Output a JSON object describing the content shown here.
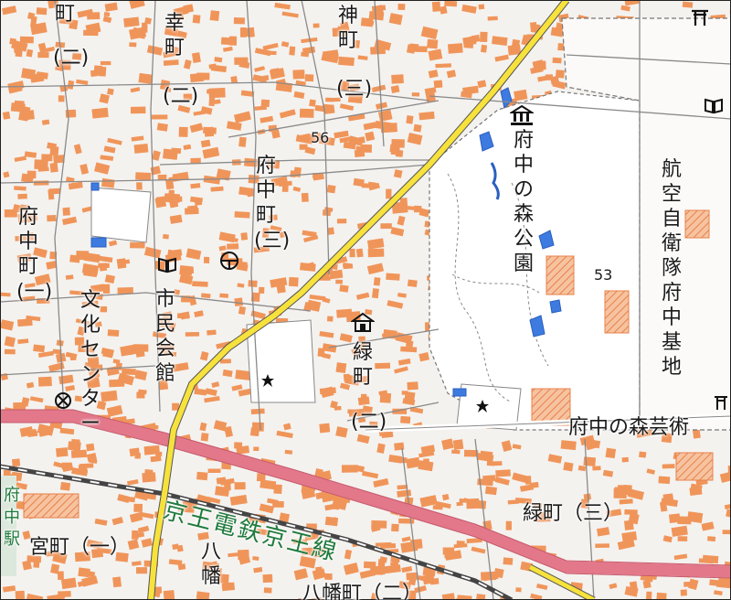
{
  "labels": {
    "saiwai": "幸町",
    "saiwai_ni": "(二)",
    "shin": "神町",
    "shin_san": "(三)",
    "fuchu_right": "府中町",
    "fuchu_right_san": "(三)",
    "fuchu_left": "府中町",
    "fuchu_left_ichi": "(一)",
    "machi_top": "町",
    "machi_top_paren": "(二)",
    "bunka": "文化センター",
    "shimin": "市民会館",
    "midori": "緑町",
    "midori_ni": "(二)",
    "mori_park": "府中の森公園",
    "koku": "航空自衛隊府中基地",
    "geijutsu": "府中の森芸術",
    "midori_san": "緑町（三）",
    "miya": "宮町（一）",
    "hachiman_v": "八幡",
    "hachiman_bottom": "八幡町（二）",
    "railway": "京王電鉄京王線",
    "station_partial": "府中駅",
    "elev_56": "56",
    "elev_53": "53"
  },
  "colors": {
    "background": "#f4f2ef",
    "building": "#f0955a",
    "major_road": "#f7e23c",
    "highway": "#e2788a",
    "water": "#3d7be0",
    "railway": "#555555",
    "park": "#ffffff"
  },
  "icons": [
    "museum-icon",
    "library-icon",
    "subway-icon",
    "post-office-icon",
    "monument-icon",
    "shrine-icon"
  ]
}
